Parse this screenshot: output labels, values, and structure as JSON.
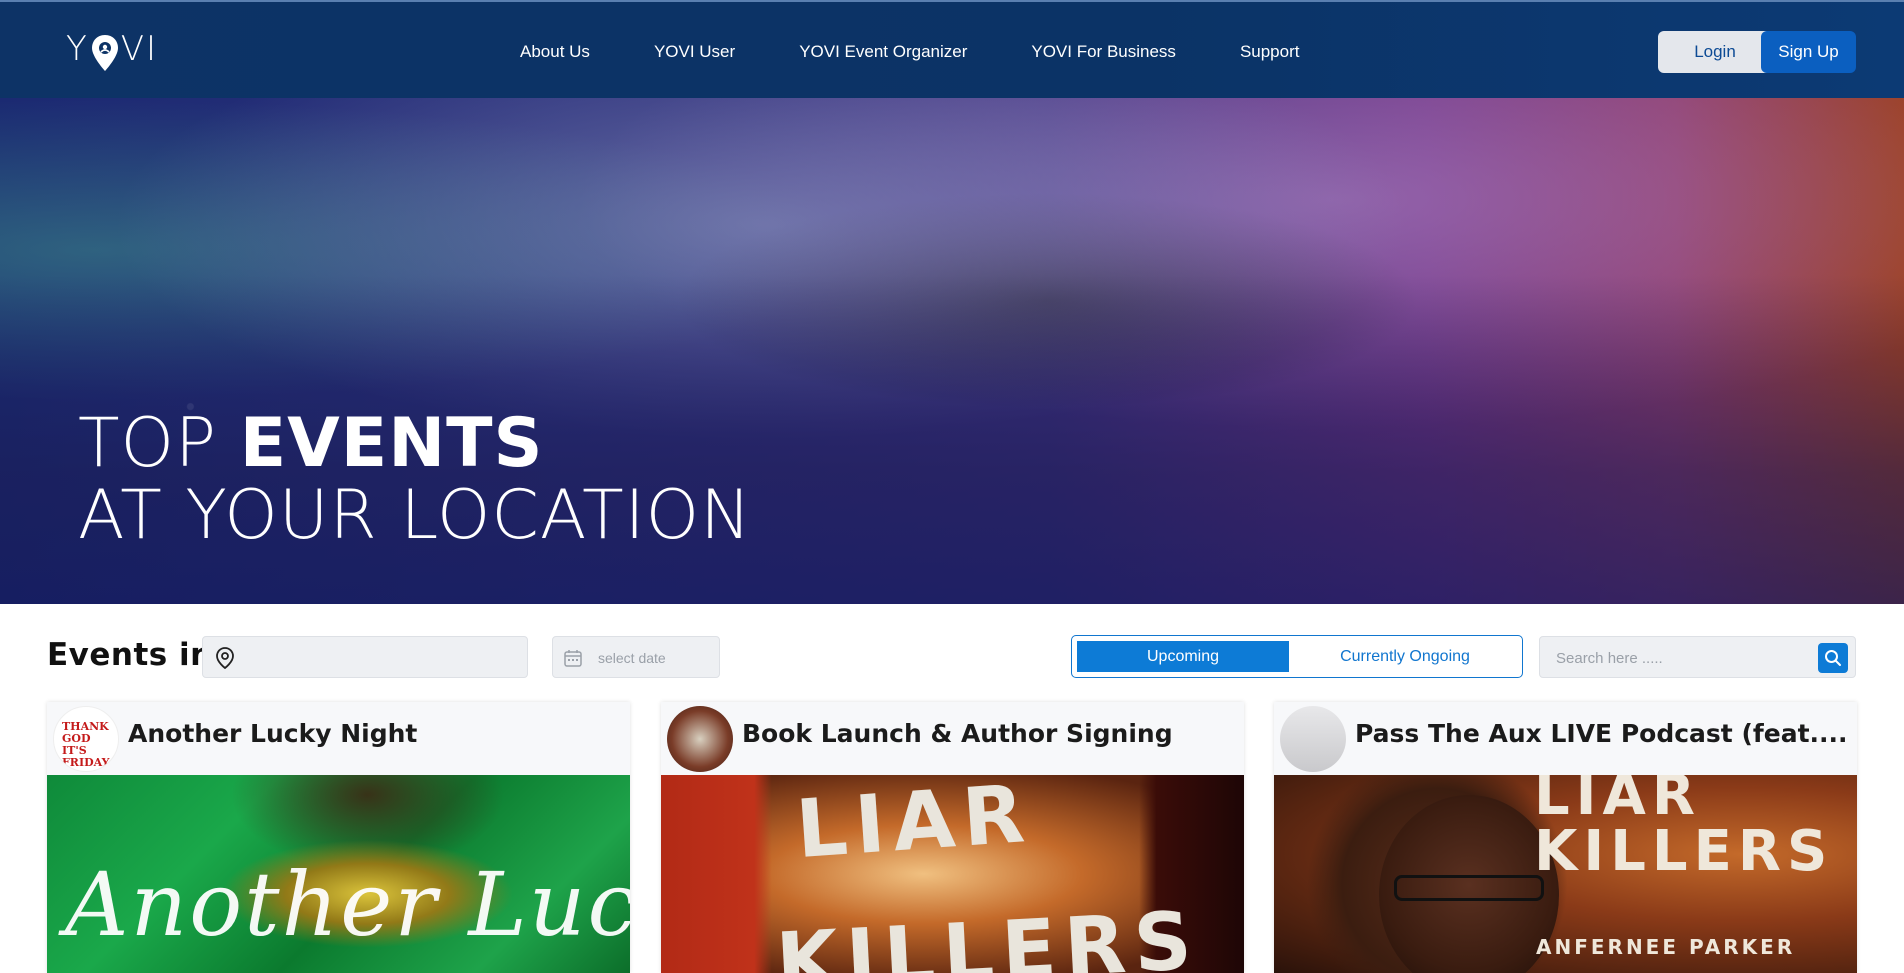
{
  "header": {
    "logo_text": "YOVI",
    "nav": [
      "About Us",
      "YOVI User",
      "YOVI Event Organizer",
      "YOVI For Business",
      "Support"
    ],
    "login_label": "Login",
    "signup_label": "Sign Up"
  },
  "hero": {
    "line1_light": "TOP ",
    "line1_bold": "EVENTS",
    "line2": "AT YOUR LOCATION"
  },
  "filters": {
    "events_in_label": "Events in",
    "location_value": "",
    "date_placeholder": "select date",
    "toggle_active": "Upcoming",
    "toggle_inactive": "Currently Ongoing",
    "search_placeholder": "Search here ....."
  },
  "events": [
    {
      "title": "Another Lucky Night",
      "avatar_text": "THANK GOD IT'S FRIDAY",
      "image_text": "Another Luc"
    },
    {
      "title": "Book Launch & Author Signing",
      "image_text_1": "LIAR",
      "image_text_2": "KILLERS"
    },
    {
      "title": "Pass The Aux LIVE Podcast (feat....",
      "image_text_1": "LIAR",
      "image_text_2": "KILLERS",
      "image_text_3": "ANFERNEE PARKER"
    }
  ],
  "colors": {
    "header_bg": "#0b3366",
    "accent_blue": "#0d7bd6",
    "signup_bg": "#0b5fc0"
  }
}
